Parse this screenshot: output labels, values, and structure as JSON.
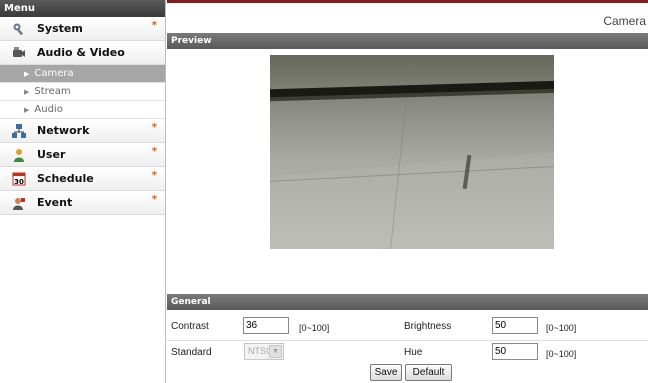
{
  "sidebar": {
    "header": "Menu",
    "items": [
      {
        "label": "System",
        "icon": "wrench-icon",
        "has_star": true
      },
      {
        "label": "Audio & Video",
        "icon": "camera-icon",
        "has_star": false,
        "children": [
          {
            "label": "Camera",
            "active": true
          },
          {
            "label": "Stream",
            "active": false
          },
          {
            "label": "Audio",
            "active": false
          }
        ]
      },
      {
        "label": "Network",
        "icon": "network-icon",
        "has_star": true
      },
      {
        "label": "User",
        "icon": "user-icon",
        "has_star": true
      },
      {
        "label": "Schedule",
        "icon": "calendar-icon",
        "calendar_text": "30",
        "has_star": true
      },
      {
        "label": "Event",
        "icon": "event-icon",
        "has_star": true
      }
    ],
    "star_glyph": "*"
  },
  "page": {
    "title": "Camera",
    "accent_color": "#8a1a1a"
  },
  "preview": {
    "header": "Preview"
  },
  "general": {
    "header": "General",
    "contrast": {
      "label": "Contrast",
      "value": "36",
      "range": "[0~100]"
    },
    "brightness": {
      "label": "Brightness",
      "value": "50",
      "range": "[0~100]"
    },
    "standard": {
      "label": "Standard",
      "value": "NTSC"
    },
    "hue": {
      "label": "Hue",
      "value": "50",
      "range": "[0~100]"
    }
  },
  "buttons": {
    "save": "Save",
    "default": "Default"
  }
}
